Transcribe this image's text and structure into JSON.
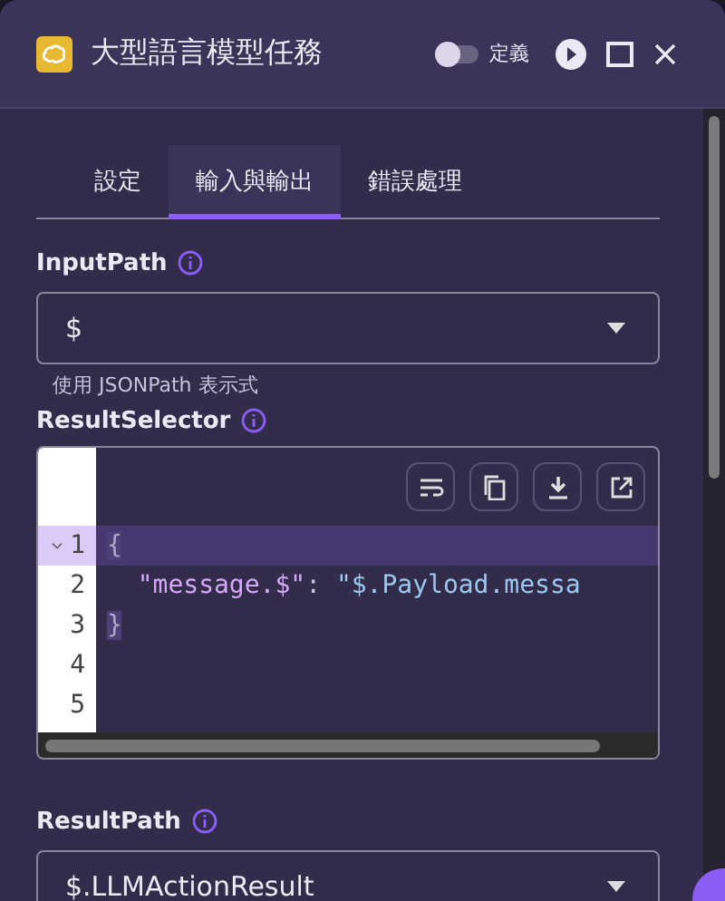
{
  "window": {
    "title": "大型語言模型任務",
    "definition_toggle": {
      "label": "定義",
      "on": false
    }
  },
  "tabs": [
    {
      "label": "設定",
      "selected": false
    },
    {
      "label": "輸入與輸出",
      "selected": true
    },
    {
      "label": "錯誤處理",
      "selected": false
    }
  ],
  "input_path": {
    "label": "InputPath",
    "value": "$",
    "hint": "使用 JSONPath 表示式"
  },
  "result_selector": {
    "label": "ResultSelector",
    "lines": [
      {
        "number": "1",
        "active": true,
        "foldable": true,
        "tokens": [
          {
            "kind": "bracket",
            "text": "{"
          }
        ]
      },
      {
        "number": "2",
        "active": false,
        "foldable": false,
        "tokens": [
          {
            "kind": "key",
            "text": "  \"message.$\""
          },
          {
            "kind": "punct",
            "text": ": "
          },
          {
            "kind": "string",
            "text": "\"$.Payload.messa"
          }
        ]
      },
      {
        "number": "3",
        "active": false,
        "foldable": false,
        "tokens": [
          {
            "kind": "bracket",
            "text": "}"
          }
        ]
      },
      {
        "number": "4",
        "active": false,
        "foldable": false
      },
      {
        "number": "5",
        "active": false,
        "foldable": false
      }
    ]
  },
  "result_path": {
    "label": "ResultPath",
    "value": "$.LLMActionResult"
  }
}
